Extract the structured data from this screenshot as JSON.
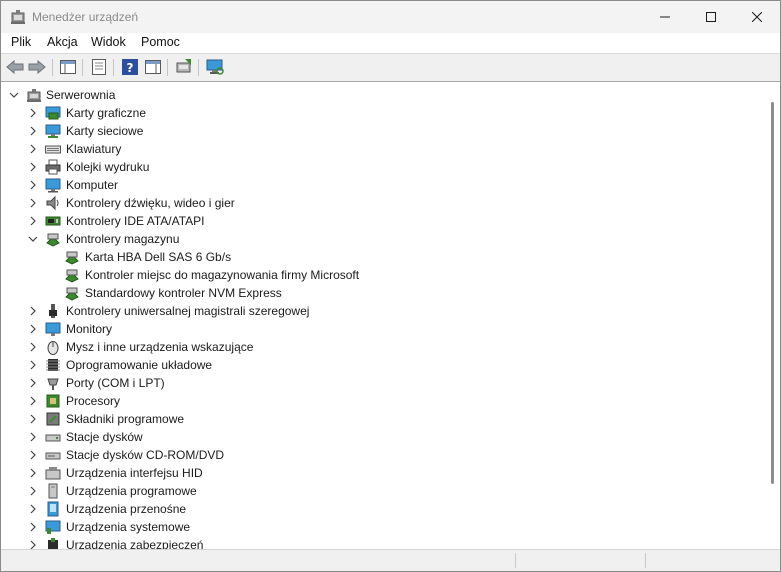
{
  "window": {
    "title": "Menedżer urządzeń"
  },
  "menu": [
    "Plik",
    "Akcja",
    "Widok",
    "Pomoc"
  ],
  "toolbar": {
    "buttons": [
      "back-icon",
      "forward-icon",
      "show-hide-console-tree-icon",
      "properties-icon",
      "help-icon",
      "action-pane-icon",
      "update-driver-icon",
      "scan-hardware-icon"
    ]
  },
  "tree": {
    "root": "Serwerownia",
    "nodes": [
      {
        "label": "Karty graficzne",
        "icon": "display-adapter-icon",
        "expanded": false
      },
      {
        "label": "Karty sieciowe",
        "icon": "network-adapter-icon",
        "expanded": false
      },
      {
        "label": "Klawiatury",
        "icon": "keyboard-icon",
        "expanded": false
      },
      {
        "label": "Kolejki wydruku",
        "icon": "printer-icon",
        "expanded": false
      },
      {
        "label": "Komputer",
        "icon": "computer-icon",
        "expanded": false
      },
      {
        "label": "Kontrolery dźwięku, wideo i gier",
        "icon": "speaker-icon",
        "expanded": false
      },
      {
        "label": "Kontrolery IDE ATA/ATAPI",
        "icon": "ide-controller-icon",
        "expanded": false
      },
      {
        "label": "Kontrolery magazynu",
        "icon": "storage-controller-icon",
        "expanded": true,
        "children": [
          "Karta HBA Dell SAS 6 Gb/s",
          "Kontroler miejsc do magazynowania firmy Microsoft",
          "Standardowy kontroler NVM Express"
        ]
      },
      {
        "label": "Kontrolery uniwersalnej magistrali szeregowej",
        "icon": "usb-icon",
        "expanded": false
      },
      {
        "label": "Monitory",
        "icon": "monitor-icon",
        "expanded": false
      },
      {
        "label": "Mysz i inne urządzenia wskazujące",
        "icon": "mouse-icon",
        "expanded": false
      },
      {
        "label": "Oprogramowanie układowe",
        "icon": "firmware-icon",
        "expanded": false
      },
      {
        "label": "Porty (COM i LPT)",
        "icon": "port-icon",
        "expanded": false
      },
      {
        "label": "Procesory",
        "icon": "processor-icon",
        "expanded": false
      },
      {
        "label": "Składniki programowe",
        "icon": "software-component-icon",
        "expanded": false
      },
      {
        "label": "Stacje dysków",
        "icon": "disk-drive-icon",
        "expanded": false
      },
      {
        "label": "Stacje dysków CD-ROM/DVD",
        "icon": "dvd-drive-icon",
        "expanded": false
      },
      {
        "label": "Urządzenia interfejsu HID",
        "icon": "hid-icon",
        "expanded": false
      },
      {
        "label": "Urządzenia programowe",
        "icon": "software-device-icon",
        "expanded": false
      },
      {
        "label": "Urządzenia przenośne",
        "icon": "portable-device-icon",
        "expanded": false
      },
      {
        "label": "Urządzenia systemowe",
        "icon": "system-device-icon",
        "expanded": false
      },
      {
        "label": "Urządzenia zabezpieczeń",
        "icon": "security-device-icon",
        "expanded": false
      }
    ]
  },
  "colors": {
    "accent": "#2b73c4",
    "monitor_screen": "#3a9ad9",
    "chip_green": "#3c8a2e"
  }
}
